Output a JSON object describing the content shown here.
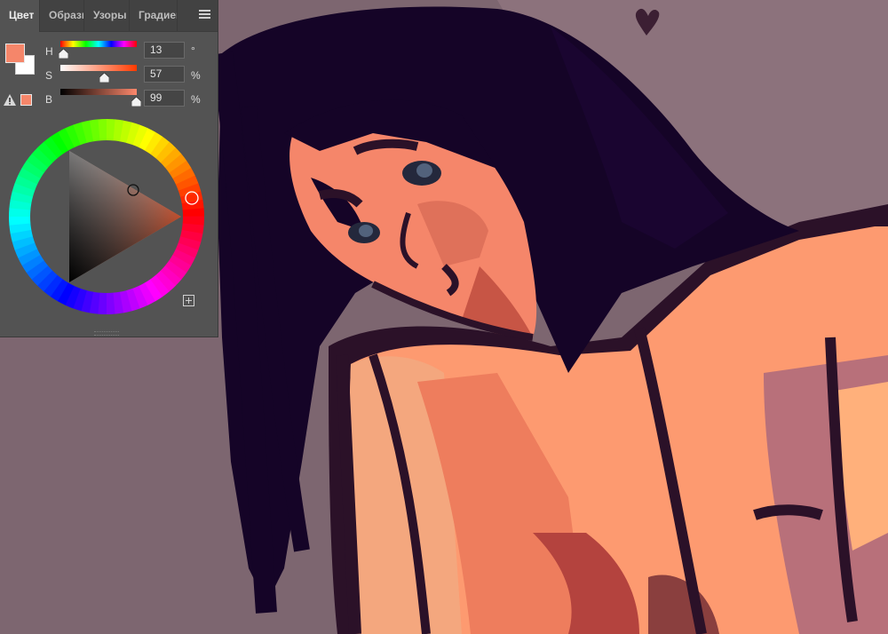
{
  "panel": {
    "tabs": [
      {
        "label": "Цвет",
        "active": true
      },
      {
        "label": "Образцы",
        "active": false
      },
      {
        "label": "Узоры",
        "active": false
      },
      {
        "label": "Градиенты",
        "active": false
      }
    ],
    "menu_icon": "panel-menu-icon",
    "foreground_color": "#f5866a",
    "background_color": "#ffffff",
    "gamut_warning_color": "#f5866a",
    "sliders": {
      "h": {
        "label": "H",
        "value": "13",
        "unit": "°",
        "fraction": 0.036
      },
      "s": {
        "label": "S",
        "value": "57",
        "unit": "%",
        "fraction": 0.57
      },
      "b": {
        "label": "B",
        "value": "99",
        "unit": "%",
        "fraction": 0.99
      }
    },
    "wheel": {
      "hue_marker_color": "hue 13°",
      "triangle_hue": "#ff3a00"
    },
    "add_icon": "add-swatch-icon"
  },
  "canvas": {
    "background_color": "#7d6670",
    "heart_icon": "heart-icon"
  }
}
